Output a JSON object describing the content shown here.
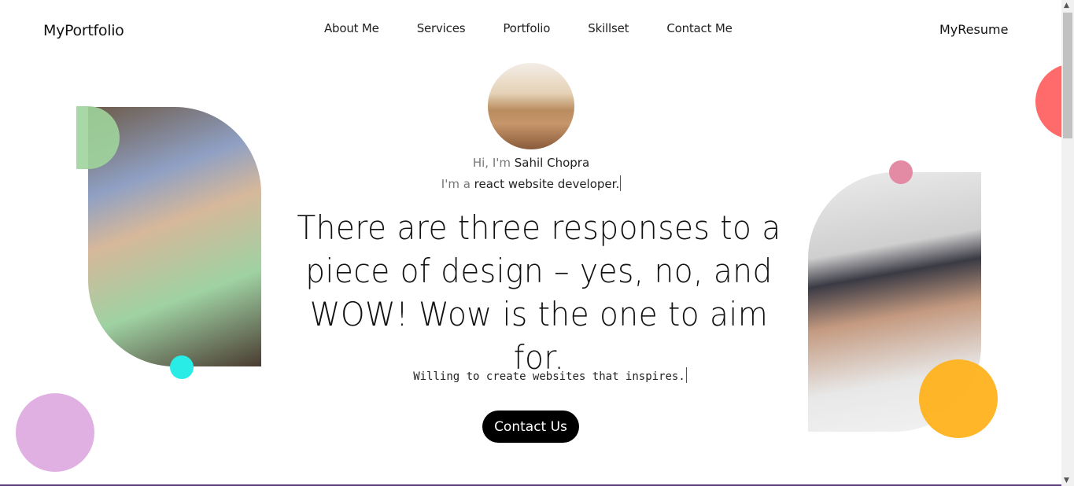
{
  "header": {
    "brand": "MyPortfolio",
    "nav": [
      "About Me",
      "Services",
      "Portfolio",
      "Skillset",
      "Contact Me"
    ],
    "resume": "MyResume"
  },
  "hero": {
    "greeting_prefix": "Hi, I'm",
    "name": "Sahil Chopra",
    "role_prefix": "I'm a",
    "role": "react website developer.",
    "quote": "There are three responses to a piece of design – yes, no, and WOW! Wow is the one to aim for.",
    "tagline": "Willing to create websites that inspires.",
    "cta": "Contact Us"
  },
  "colors": {
    "red": "#ff6b6b",
    "green": "#9ed49b",
    "cyan": "#29ece6",
    "violet": "#e1b0e2",
    "pink": "#e38aa5",
    "orange": "#ffb21d"
  }
}
